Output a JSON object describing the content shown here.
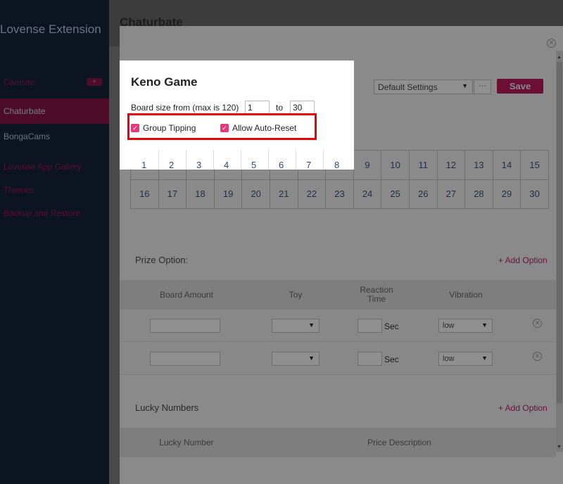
{
  "app": {
    "title": "Lovense Extension"
  },
  "sidebar": {
    "camsite_label": "Camsite",
    "plus": "+",
    "items": [
      {
        "label": "Chaturbate"
      },
      {
        "label": "BongaCams"
      }
    ],
    "links": [
      "Lovense App Gallery",
      "Themes",
      "Backup and Restore"
    ]
  },
  "header": {
    "title": "Chaturbate"
  },
  "toolbar": {
    "settings_value": "Default Settings",
    "more_label": "···",
    "save_label": "Save"
  },
  "keno": {
    "title": "Keno Game",
    "board_size_label": "Board size from (max is 120)",
    "board_from": "1",
    "to_label": "to",
    "board_to": "30",
    "group_tipping_label": "Group Tipping",
    "group_tipping_checked": true,
    "auto_reset_label": "Allow Auto-Reset",
    "auto_reset_checked": true
  },
  "board": {
    "row1": [
      "1",
      "2",
      "3",
      "4",
      "5",
      "6",
      "7",
      "8",
      "9",
      "10",
      "11",
      "12",
      "13",
      "14",
      "15"
    ],
    "row2": [
      "16",
      "17",
      "18",
      "19",
      "20",
      "21",
      "22",
      "23",
      "24",
      "25",
      "26",
      "27",
      "28",
      "29",
      "30"
    ]
  },
  "prize": {
    "label": "Prize Option:",
    "add_option": "+ Add Option",
    "columns": [
      "Board Amount",
      "Toy",
      "Reaction Time",
      "Vibration"
    ],
    "rows": [
      {
        "sec": "Sec",
        "vibration": "low"
      },
      {
        "sec": "Sec",
        "vibration": "low"
      }
    ]
  },
  "lucky": {
    "label": "Lucky Numbers",
    "add_option": "+ Add Option",
    "columns": [
      "Lucky Number",
      "Price Description"
    ]
  },
  "colors": {
    "accent": "#e33a7b",
    "highlight": "#e8000a"
  }
}
